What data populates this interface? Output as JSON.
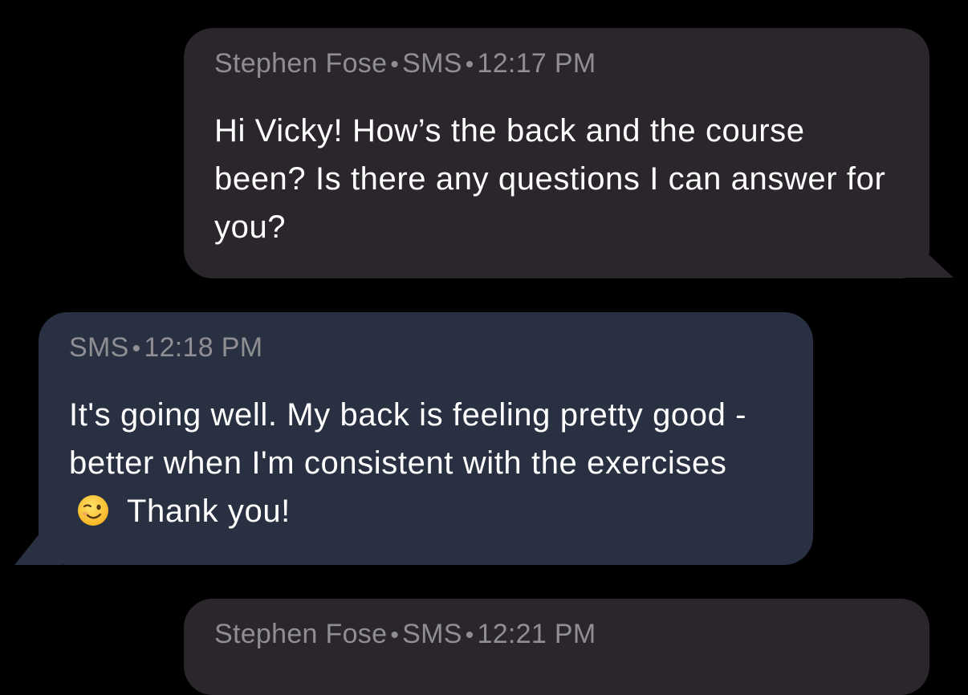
{
  "messages": [
    {
      "direction": "outgoing",
      "sender": "Stephen Fose",
      "channel": "SMS",
      "time": "12:17 PM",
      "text": "Hi Vicky! How’s the back and the course been? Is there any questions I can answer for you?"
    },
    {
      "direction": "incoming",
      "channel": "SMS",
      "time": "12:18 PM",
      "text_before_emoji": "It's going well. My back is feeling pretty good - better when I'm consistent with the exercises",
      "emoji": "winking-face-emoji",
      "text_after_emoji": "Thank you!"
    },
    {
      "direction": "outgoing",
      "sender": "Stephen Fose",
      "channel": "SMS",
      "time": "12:21 PM"
    }
  ],
  "colors": {
    "background": "#000000",
    "outgoing_bubble": "#2b252c",
    "incoming_bubble": "#283041",
    "meta_text": "#8e8e93",
    "message_text": "#ffffff"
  }
}
